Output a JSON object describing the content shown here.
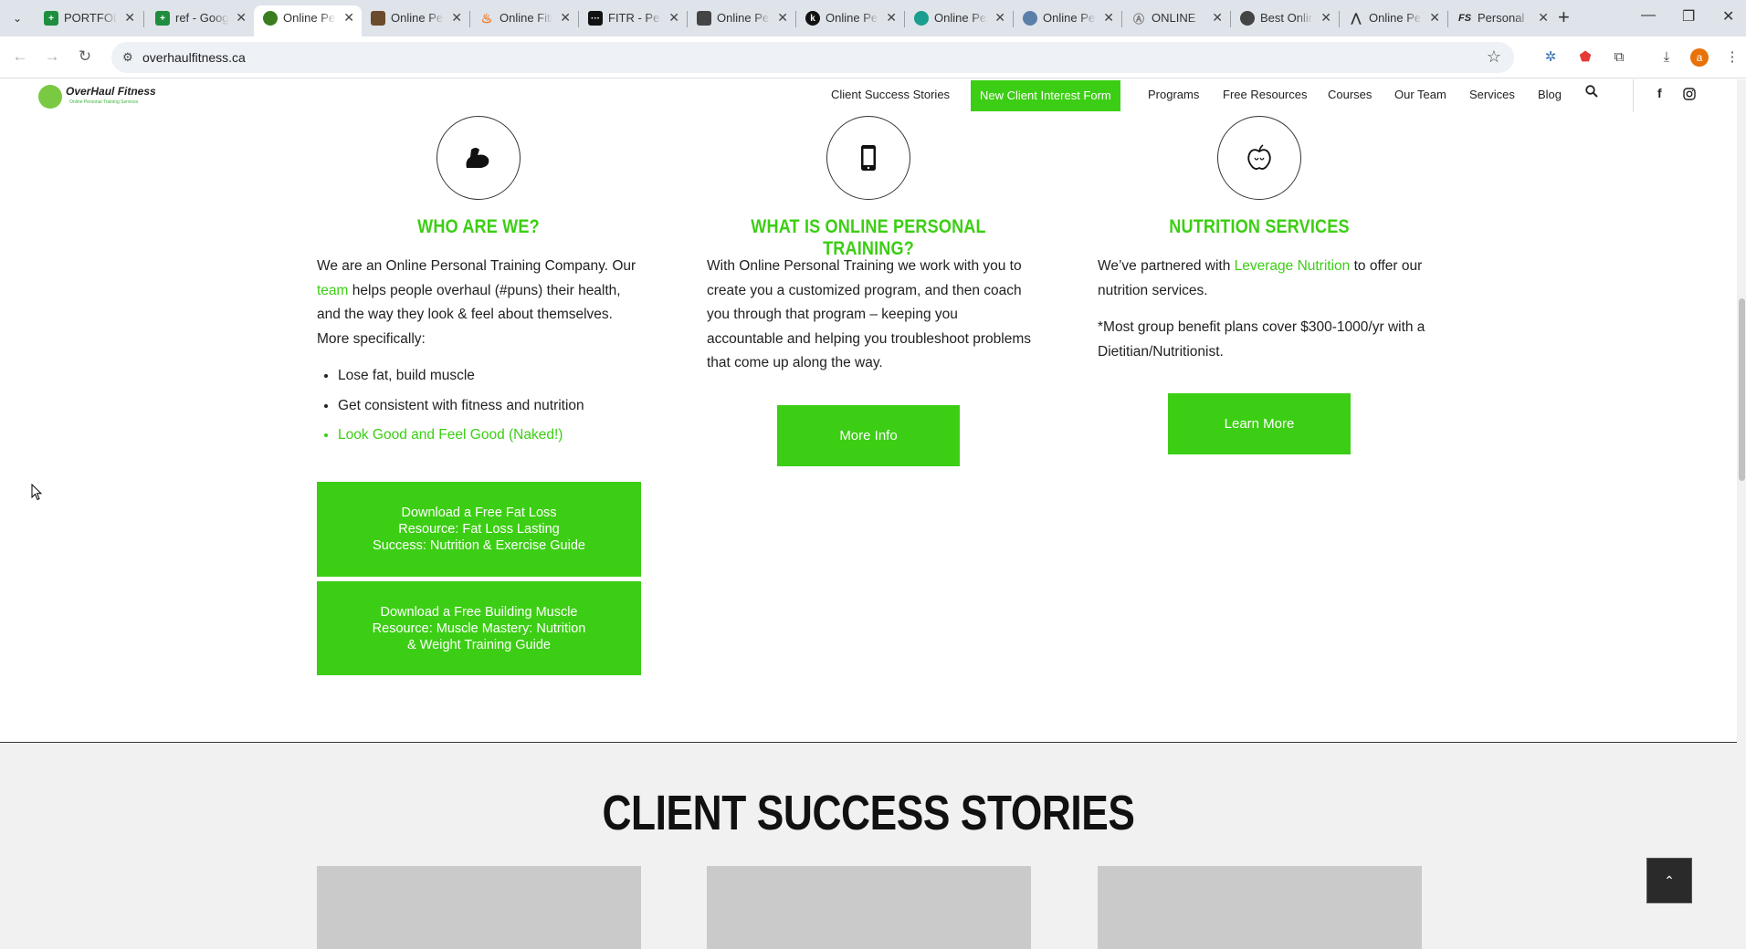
{
  "browser": {
    "tabs": [
      {
        "title": "PORTFOLIO",
        "favicon": "sheets-icon",
        "color": "#1e8e3e"
      },
      {
        "title": "ref - Google Sheets",
        "favicon": "sheets-icon",
        "color": "#1e8e3e"
      },
      {
        "title": "Online Personal Training",
        "favicon": "overhaul-icon",
        "color": "#3a7d1e",
        "active": true
      },
      {
        "title": "Online Personal Trainer",
        "favicon": "photo-icon",
        "color": "#6b4b2a"
      },
      {
        "title": "Online Fitness",
        "favicon": "flame-icon",
        "color": "#f07b22"
      },
      {
        "title": "FITR - Personal",
        "favicon": "fitr-icon",
        "color": "#111111"
      },
      {
        "title": "Online Personal",
        "favicon": "cube-icon",
        "color": "#444444"
      },
      {
        "title": "Online Personal",
        "favicon": "k-icon",
        "color": "#111111"
      },
      {
        "title": "Online Personal",
        "favicon": "chart-icon",
        "color": "#1a9e8f"
      },
      {
        "title": "Online Personal",
        "favicon": "globe-icon",
        "color": "#5a7fa8"
      },
      {
        "title": "ONLINE",
        "favicon": "runner-icon",
        "color": "#777777"
      },
      {
        "title": "Best Online",
        "favicon": "globe-icon",
        "color": "#444444"
      },
      {
        "title": "Online Personal",
        "favicon": "mountain-icon",
        "color": "#333333"
      },
      {
        "title": "Personal",
        "favicon": "fs-icon",
        "color": "#222222"
      }
    ],
    "url": "overhaulfitness.ca",
    "profile_initial": "a"
  },
  "header": {
    "logo_name": "OverHaul Fitness",
    "logo_tagline": "Online Personal Training Services",
    "nav": {
      "client_success": "Client Success Stories",
      "interest_form": "New Client Interest Form",
      "programs": "Programs",
      "free_resources": "Free Resources",
      "courses": "Courses",
      "our_team": "Our Team",
      "services": "Services",
      "blog": "Blog"
    }
  },
  "columns": {
    "who": {
      "title": "WHO ARE WE?",
      "p1_a": "We are an Online Personal Training Company. Our ",
      "p1_link": "team",
      "p1_b": " helps people overhaul (#puns) their health, and the way they look & feel about themselves. More specifically:",
      "bullets": [
        "Lose fat, build muscle",
        "Get consistent with fitness and nutrition",
        "Look Good and Feel Good (Naked!)"
      ],
      "btn_fat_loss": "Download a Free Fat Loss Resource: Fat Loss Lasting Success: Nutrition & Exercise Guide",
      "btn_muscle": "Download a Free Building Muscle Resource: Muscle Mastery: Nutrition & Weight Training Guide"
    },
    "what": {
      "title": "WHAT IS ONLINE PERSONAL TRAINING?",
      "p1": "With Online Personal Training we work with you to create you a customized program, and then coach you through that program – keeping you accountable and helping you troubleshoot problems that come up along the way.",
      "btn": "More Info"
    },
    "nutrition": {
      "title": "NUTRITION SERVICES",
      "p1_a": "We’ve partnered with ",
      "p1_link": "Leverage Nutrition",
      "p1_b": " to offer our nutrition services.",
      "p2": "*Most group benefit plans cover $300-1000/yr with a Dietitian/Nutritionist.",
      "btn": "Learn More"
    }
  },
  "stories": {
    "title": "CLIENT SUCCESS STORIES"
  },
  "colors": {
    "accent": "#3cce14",
    "text": "#222222",
    "stories_bg": "#f1f1f1"
  }
}
